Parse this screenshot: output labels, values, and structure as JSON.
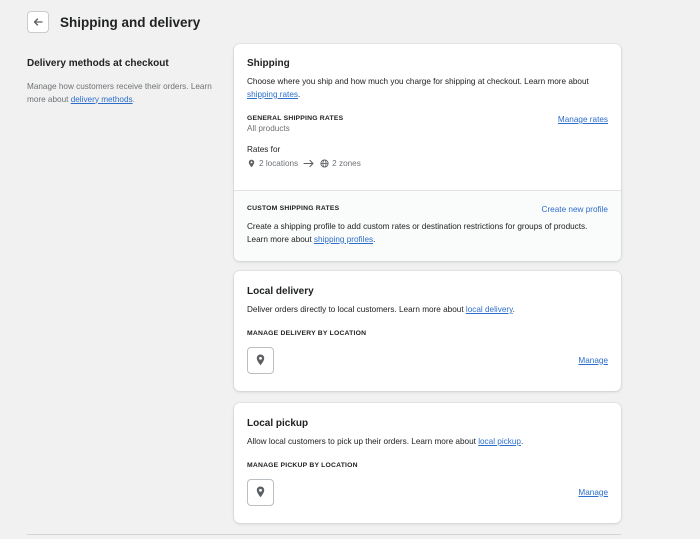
{
  "header": {
    "title": "Shipping and delivery",
    "back_icon": "arrow-left-icon"
  },
  "section": {
    "title": "Delivery methods at checkout",
    "desc_prefix": "Manage how customers receive their orders. Learn more about ",
    "desc_link": "delivery methods",
    "desc_suffix": "."
  },
  "shipping_card": {
    "title": "Shipping",
    "desc_prefix": "Choose where you ship and how much you charge for shipping at checkout. Learn more about ",
    "desc_link": "shipping rates",
    "desc_suffix": ".",
    "general": {
      "heading": "GENERAL SHIPPING RATES",
      "subtext": "All products",
      "manage_link": "Manage rates",
      "rates_for": "Rates for",
      "locations": "2 locations",
      "zones": "2 zones"
    },
    "custom": {
      "heading": "CUSTOM SHIPPING RATES",
      "create_link": "Create new profile",
      "desc_prefix": "Create a shipping profile to add custom rates or destination restrictions for groups of products. Learn more about ",
      "desc_link": "shipping profiles",
      "desc_suffix": "."
    }
  },
  "local_delivery_card": {
    "title": "Local delivery",
    "desc_prefix": "Deliver orders directly to local customers. Learn more about ",
    "desc_link": "local delivery",
    "desc_suffix": ".",
    "heading": "MANAGE DELIVERY BY LOCATION",
    "manage_link": "Manage"
  },
  "local_pickup_card": {
    "title": "Local pickup",
    "desc_prefix": "Allow local customers to pick up their orders. Learn more about ",
    "desc_link": "local pickup",
    "desc_suffix": ".",
    "heading": "MANAGE PICKUP BY LOCATION",
    "manage_link": "Manage"
  },
  "colors": {
    "link": "#2c6ecb",
    "background": "#f1f1f1",
    "card": "#ffffff",
    "muted": "#6d7175"
  }
}
